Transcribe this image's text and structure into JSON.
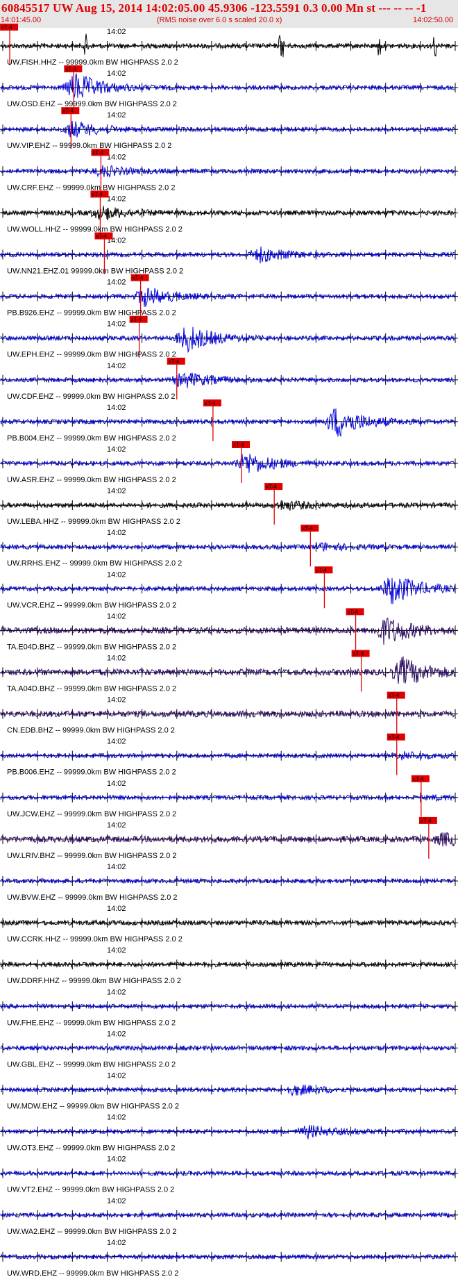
{
  "header": {
    "title": "60845517 UW Aug 15, 2014 14:02:05.00   45.9306 -123.5591  0.3 0.00 Mn st --- -- --   -1",
    "start_time": "14:01:45.00",
    "note": "(RMS noise over 6.0 s scaled 20.0 x)",
    "end_time": "14:02:50.00"
  },
  "chart_data": {
    "type": "line",
    "title": "60845517 UW Aug 15, 2014 14:02:05.00   45.9306 -123.5591  0.3 0.00 Mn st --- -- --   -1",
    "x_range": [
      "14:01:45.00",
      "14:02:50.00"
    ],
    "x_tick_label": "14:02",
    "pick_label": "xT-4",
    "colors": {
      "pick": "#e00000",
      "blue": "#0000dd",
      "black": "#000000",
      "purple": "#2a0a60"
    },
    "traces": [
      {
        "label": "UW.FISH.HHZ -- 99999.0km BW  HIGHPASS  2.0  2",
        "color": "black",
        "pick_s": 1.0,
        "burst_s": null,
        "burst_amp": 0
      },
      {
        "label": "UW.OSD.EHZ -- 99999.0km BW  HIGHPASS  2.0  2",
        "color": "blue",
        "pick_s": 10.2,
        "burst_s": 10.5,
        "burst_amp": 0.9
      },
      {
        "label": "UW.VIP.EHZ -- 99999.0km BW  HIGHPASS  2.0  2",
        "color": "blue",
        "pick_s": 9.8,
        "burst_s": 10.2,
        "burst_amp": 0.5
      },
      {
        "label": "UW.CRF.EHZ -- 99999.0km BW  HIGHPASS  2.0  2",
        "color": "blue",
        "pick_s": 14.1,
        "burst_s": 14.4,
        "burst_amp": 0.3
      },
      {
        "label": "UW.WOLL.HHZ -- 99999.0km BW  HIGHPASS  2.0  2",
        "color": "black",
        "pick_s": 14.0,
        "burst_s": 14.3,
        "burst_amp": 0.4
      },
      {
        "label": "UW.NN21.EHZ.01 99999.0km BW  HIGHPASS  2.0  2",
        "color": "blue",
        "pick_s": 14.6,
        "burst_s": 37.0,
        "burst_amp": 0.45
      },
      {
        "label": "PB.B926.EHZ -- 99999.0km BW  HIGHPASS  2.0  2",
        "color": "blue",
        "pick_s": 19.8,
        "burst_s": 20.5,
        "burst_amp": 0.6
      },
      {
        "label": "UW.EPH.EHZ -- 99999.0km BW  HIGHPASS  2.0  2",
        "color": "blue",
        "pick_s": 19.6,
        "burst_s": 26.5,
        "burst_amp": 0.85
      },
      {
        "label": "UW.CDF.EHZ -- 99999.0km BW  HIGHPASS  2.0  2",
        "color": "blue",
        "pick_s": 25.0,
        "burst_s": 26.0,
        "burst_amp": 0.5
      },
      {
        "label": "PB.B004.EHZ -- 99999.0km BW  HIGHPASS  2.0  2",
        "color": "blue",
        "pick_s": 30.2,
        "burst_s": 48.0,
        "burst_amp": 1.0
      },
      {
        "label": "UW.ASR.EHZ -- 99999.0km BW  HIGHPASS  2.0  2",
        "color": "blue",
        "pick_s": 34.3,
        "burst_s": 35.0,
        "burst_amp": 0.7
      },
      {
        "label": "UW.LEBA.HHZ -- 99999.0km BW  HIGHPASS  2.0  2",
        "color": "black",
        "pick_s": 39.0,
        "burst_s": 40.5,
        "burst_amp": 0.25
      },
      {
        "label": "UW.RRHS.EHZ -- 99999.0km BW  HIGHPASS  2.0  2",
        "color": "blue",
        "pick_s": 44.2,
        "burst_s": 46.0,
        "burst_amp": 0.2
      },
      {
        "label": "UW.VCR.EHZ -- 99999.0km BW  HIGHPASS  2.0  2",
        "color": "blue",
        "pick_s": 46.2,
        "burst_s": 56.0,
        "burst_amp": 1.0
      },
      {
        "label": "TA.E04D.BHZ -- 99999.0km BW  HIGHPASS  2.0  2",
        "color": "purple",
        "pick_s": 50.7,
        "burst_s": 55.0,
        "burst_amp": 0.85
      },
      {
        "label": "TA.A04D.BHZ -- 99999.0km BW  HIGHPASS  2.0  2",
        "color": "purple",
        "pick_s": 51.5,
        "burst_s": 57.5,
        "burst_amp": 0.85
      },
      {
        "label": "CN.EDB.BHZ -- 99999.0km BW  HIGHPASS  2.0  2",
        "color": "purple",
        "pick_s": 56.6,
        "burst_s": null,
        "burst_amp": 0
      },
      {
        "label": "PB.B006.EHZ -- 99999.0km BW  HIGHPASS  2.0  2",
        "color": "blue",
        "pick_s": 56.6,
        "burst_s": 57.5,
        "burst_amp": 0.2
      },
      {
        "label": "UW.JCW.EHZ -- 99999.0km BW  HIGHPASS  2.0  2",
        "color": "blue",
        "pick_s": 60.1,
        "burst_s": 62.5,
        "burst_amp": 0.1
      },
      {
        "label": "UW.LRIV.BHZ -- 99999.0km BW  HIGHPASS  2.0  2",
        "color": "purple",
        "pick_s": 61.2,
        "burst_s": 63.5,
        "burst_amp": 0.35
      },
      {
        "label": "UW.BVW.EHZ -- 99999.0km BW  HIGHPASS  2.0  2",
        "color": "blue",
        "pick_s": null,
        "burst_s": null,
        "burst_amp": 0
      },
      {
        "label": "UW.CCRK.HHZ -- 99999.0km BW  HIGHPASS  2.0  2",
        "color": "black",
        "pick_s": null,
        "burst_s": null,
        "burst_amp": 0
      },
      {
        "label": "UW.DDRF.HHZ -- 99999.0km BW  HIGHPASS  2.0  2",
        "color": "black",
        "pick_s": null,
        "burst_s": null,
        "burst_amp": 0
      },
      {
        "label": "UW.FHE.EHZ -- 99999.0km BW  HIGHPASS  2.0  2",
        "color": "blue",
        "pick_s": null,
        "burst_s": null,
        "burst_amp": 0
      },
      {
        "label": "UW.GBL.EHZ -- 99999.0km BW  HIGHPASS  2.0  2",
        "color": "blue",
        "pick_s": null,
        "burst_s": null,
        "burst_amp": 0
      },
      {
        "label": "UW.MDW.EHZ -- 99999.0km BW  HIGHPASS  2.0  2",
        "color": "blue",
        "pick_s": null,
        "burst_s": 42.0,
        "burst_amp": 0.3
      },
      {
        "label": "UW.OT3.EHZ -- 99999.0km BW  HIGHPASS  2.0  2",
        "color": "blue",
        "pick_s": null,
        "burst_s": 44.0,
        "burst_amp": 0.35
      },
      {
        "label": "UW.VT2.EHZ -- 99999.0km BW  HIGHPASS  2.0  2",
        "color": "blue",
        "pick_s": null,
        "burst_s": null,
        "burst_amp": 0
      },
      {
        "label": "UW.WA2.EHZ -- 99999.0km BW  HIGHPASS  2.0  2",
        "color": "blue",
        "pick_s": null,
        "burst_s": null,
        "burst_amp": 0
      },
      {
        "label": "UW.WRD.EHZ -- 99999.0km BW  HIGHPASS  2.0  2",
        "color": "blue",
        "pick_s": null,
        "burst_s": null,
        "burst_amp": 0
      }
    ]
  }
}
